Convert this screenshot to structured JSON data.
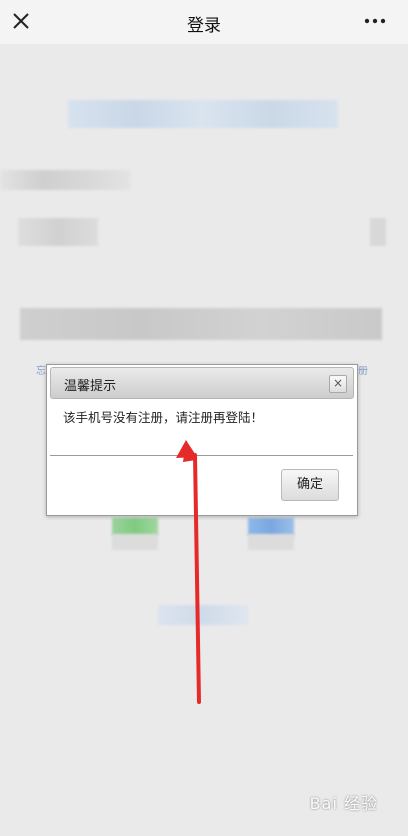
{
  "header": {
    "title": "登录",
    "close_icon": "close-icon",
    "more_icon": "more-icon"
  },
  "background": {
    "left_link_fragment": "忘",
    "right_link_fragment": "册"
  },
  "dialog": {
    "title": "温馨提示",
    "close_glyph": "×",
    "message": "该手机号没有注册，请注册再登陆！",
    "ok_label": "确定"
  },
  "annotation": {
    "arrow_color": "#e62a2a"
  },
  "watermark": {
    "text": "Bai 经验"
  }
}
